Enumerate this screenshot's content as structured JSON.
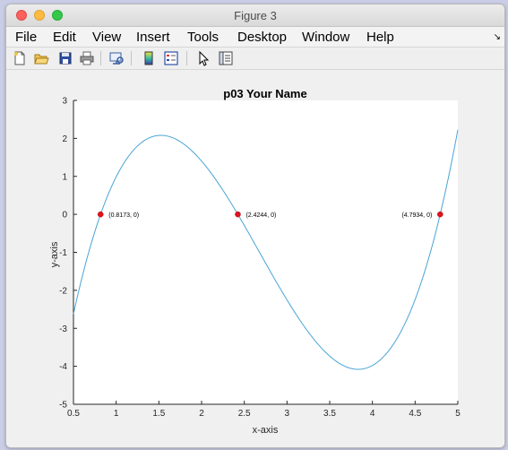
{
  "window": {
    "title": "Figure 3"
  },
  "menu": {
    "items": [
      "File",
      "Edit",
      "View",
      "Insert",
      "Tools",
      "Desktop",
      "Window",
      "Help"
    ],
    "overflow_icon": "arrow-icon"
  },
  "toolbar": {
    "icons": [
      "new-figure-icon",
      "open-file-icon",
      "save-icon",
      "print-icon",
      "link-plot-icon",
      "insert-colorbar-icon",
      "insert-legend-icon",
      "pointer-icon",
      "property-inspector-icon"
    ]
  },
  "chart_data": {
    "type": "line",
    "title": "p03 Your Name",
    "xlabel": "x-axis",
    "ylabel": "y-axis",
    "xlim": [
      0.5,
      5
    ],
    "ylim": [
      -5,
      3
    ],
    "xticks": [
      0.5,
      1,
      1.5,
      2,
      2.5,
      3,
      3.5,
      4,
      4.5,
      5
    ],
    "yticks": [
      -5,
      -4,
      -3,
      -2,
      -1,
      0,
      1,
      2,
      3
    ],
    "grid": false,
    "series": [
      {
        "color": "#4aa4d6",
        "roots": [
          0.8173,
          2.4244,
          4.7934
        ],
        "leading_coefficient": 1,
        "x": [
          0.5,
          0.8173,
          1,
          1.5,
          2,
          2.4244,
          3,
          3.5,
          3.84,
          4,
          4.5,
          4.7934,
          5
        ],
        "y": [
          -2.7,
          0,
          1.07,
          2.1,
          1.07,
          0,
          -2.61,
          -3.83,
          -4.1,
          -3.95,
          -2.24,
          0,
          2.23
        ]
      }
    ],
    "markers": [
      {
        "x": 0.8173,
        "y": 0,
        "label": "(0.8173, 0)",
        "color": "#e0141e"
      },
      {
        "x": 2.4244,
        "y": 0,
        "label": "(2.4244, 0)",
        "color": "#e0141e"
      },
      {
        "x": 4.7934,
        "y": 0,
        "label": "(4.7934, 0)",
        "color": "#e0141e"
      }
    ]
  }
}
